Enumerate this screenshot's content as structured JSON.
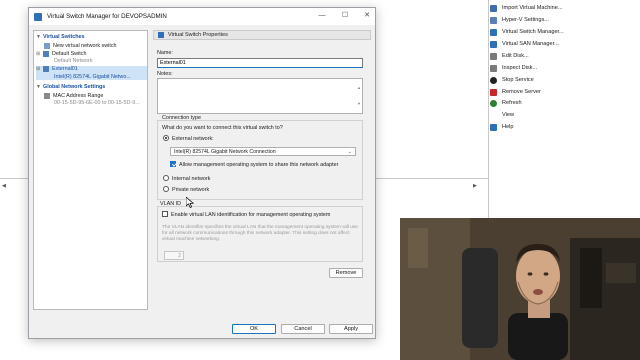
{
  "background_window": {
    "actions": [
      {
        "label": "Import Virtual Machine...",
        "icon": "import-icon",
        "color": "#3f6ea8"
      },
      {
        "label": "Hyper-V Settings...",
        "icon": "settings-icon",
        "color": "#5a7fb0"
      },
      {
        "label": "Virtual Switch Manager...",
        "icon": "switch-icon",
        "color": "#2f6fb3"
      },
      {
        "label": "Virtual SAN Manager...",
        "icon": "san-icon",
        "color": "#2f6fb3"
      },
      {
        "label": "Edit Disk...",
        "icon": "edit-disk-icon",
        "color": "#6d6d6d"
      },
      {
        "label": "Inspect Disk...",
        "icon": "inspect-disk-icon",
        "color": "#6d6d6d"
      },
      {
        "label": "Stop Service",
        "icon": "stop-icon",
        "color": "#222222"
      },
      {
        "label": "Remove Server",
        "icon": "remove-icon",
        "color": "#c62828"
      },
      {
        "label": "Refresh",
        "icon": "refresh-icon",
        "color": "#2e7d32"
      },
      {
        "label": "View",
        "icon": "",
        "color": "#ffffff"
      },
      {
        "label": "Help",
        "icon": "help-icon",
        "color": "#2f6fb3"
      }
    ]
  },
  "dialog": {
    "title": "Virtual Switch Manager for DEVOPSADMIN",
    "window_buttons": {
      "minimize": "—",
      "maximize": "☐",
      "close": "✕"
    },
    "tree": {
      "virtual_switches_header": "Virtual Switches",
      "new_switch": "New virtual network switch",
      "default_switch": "Default Switch",
      "default_switch_sub": "Default Network",
      "external_switch": "External01",
      "external_switch_sub": "Intel(R) 82574L Gigabit Netwo...",
      "global_header": "Global Network Settings",
      "mac_range": "MAC Address Range",
      "mac_range_sub": "00-15-5D-95-6E-00 to 00-15-5D-9..."
    },
    "properties": {
      "header": "Virtual Switch Properties",
      "name_label": "Name:",
      "name_value": "External01",
      "notes_label": "Notes:",
      "connection_type_label": "Connection type",
      "connection_question": "What do you want to connect this virtual switch to?",
      "external_label": "External network:",
      "external_adapter": "Intel(R) 82574L Gigabit Network Connection",
      "allow_mgmt_label": "Allow management operating system to share this network adapter",
      "internal_label": "Internal network",
      "private_label": "Private network",
      "vlan_label": "VLAN ID",
      "vlan_enable_label": "Enable virtual LAN identification for management operating system",
      "vlan_description": "The VLAN identifier specifies the virtual LAN that the management operating system will use for all network communications through this network adapter. This setting does not affect virtual machine networking.",
      "vlan_id_value": "2",
      "remove_label": "Remove"
    },
    "buttons": {
      "ok": "OK",
      "cancel": "Cancel",
      "apply": "Apply"
    }
  },
  "colors": {
    "accent": "#1a73c8",
    "tree_header": "#1b4fa0",
    "selection": "#cfe3f7"
  }
}
